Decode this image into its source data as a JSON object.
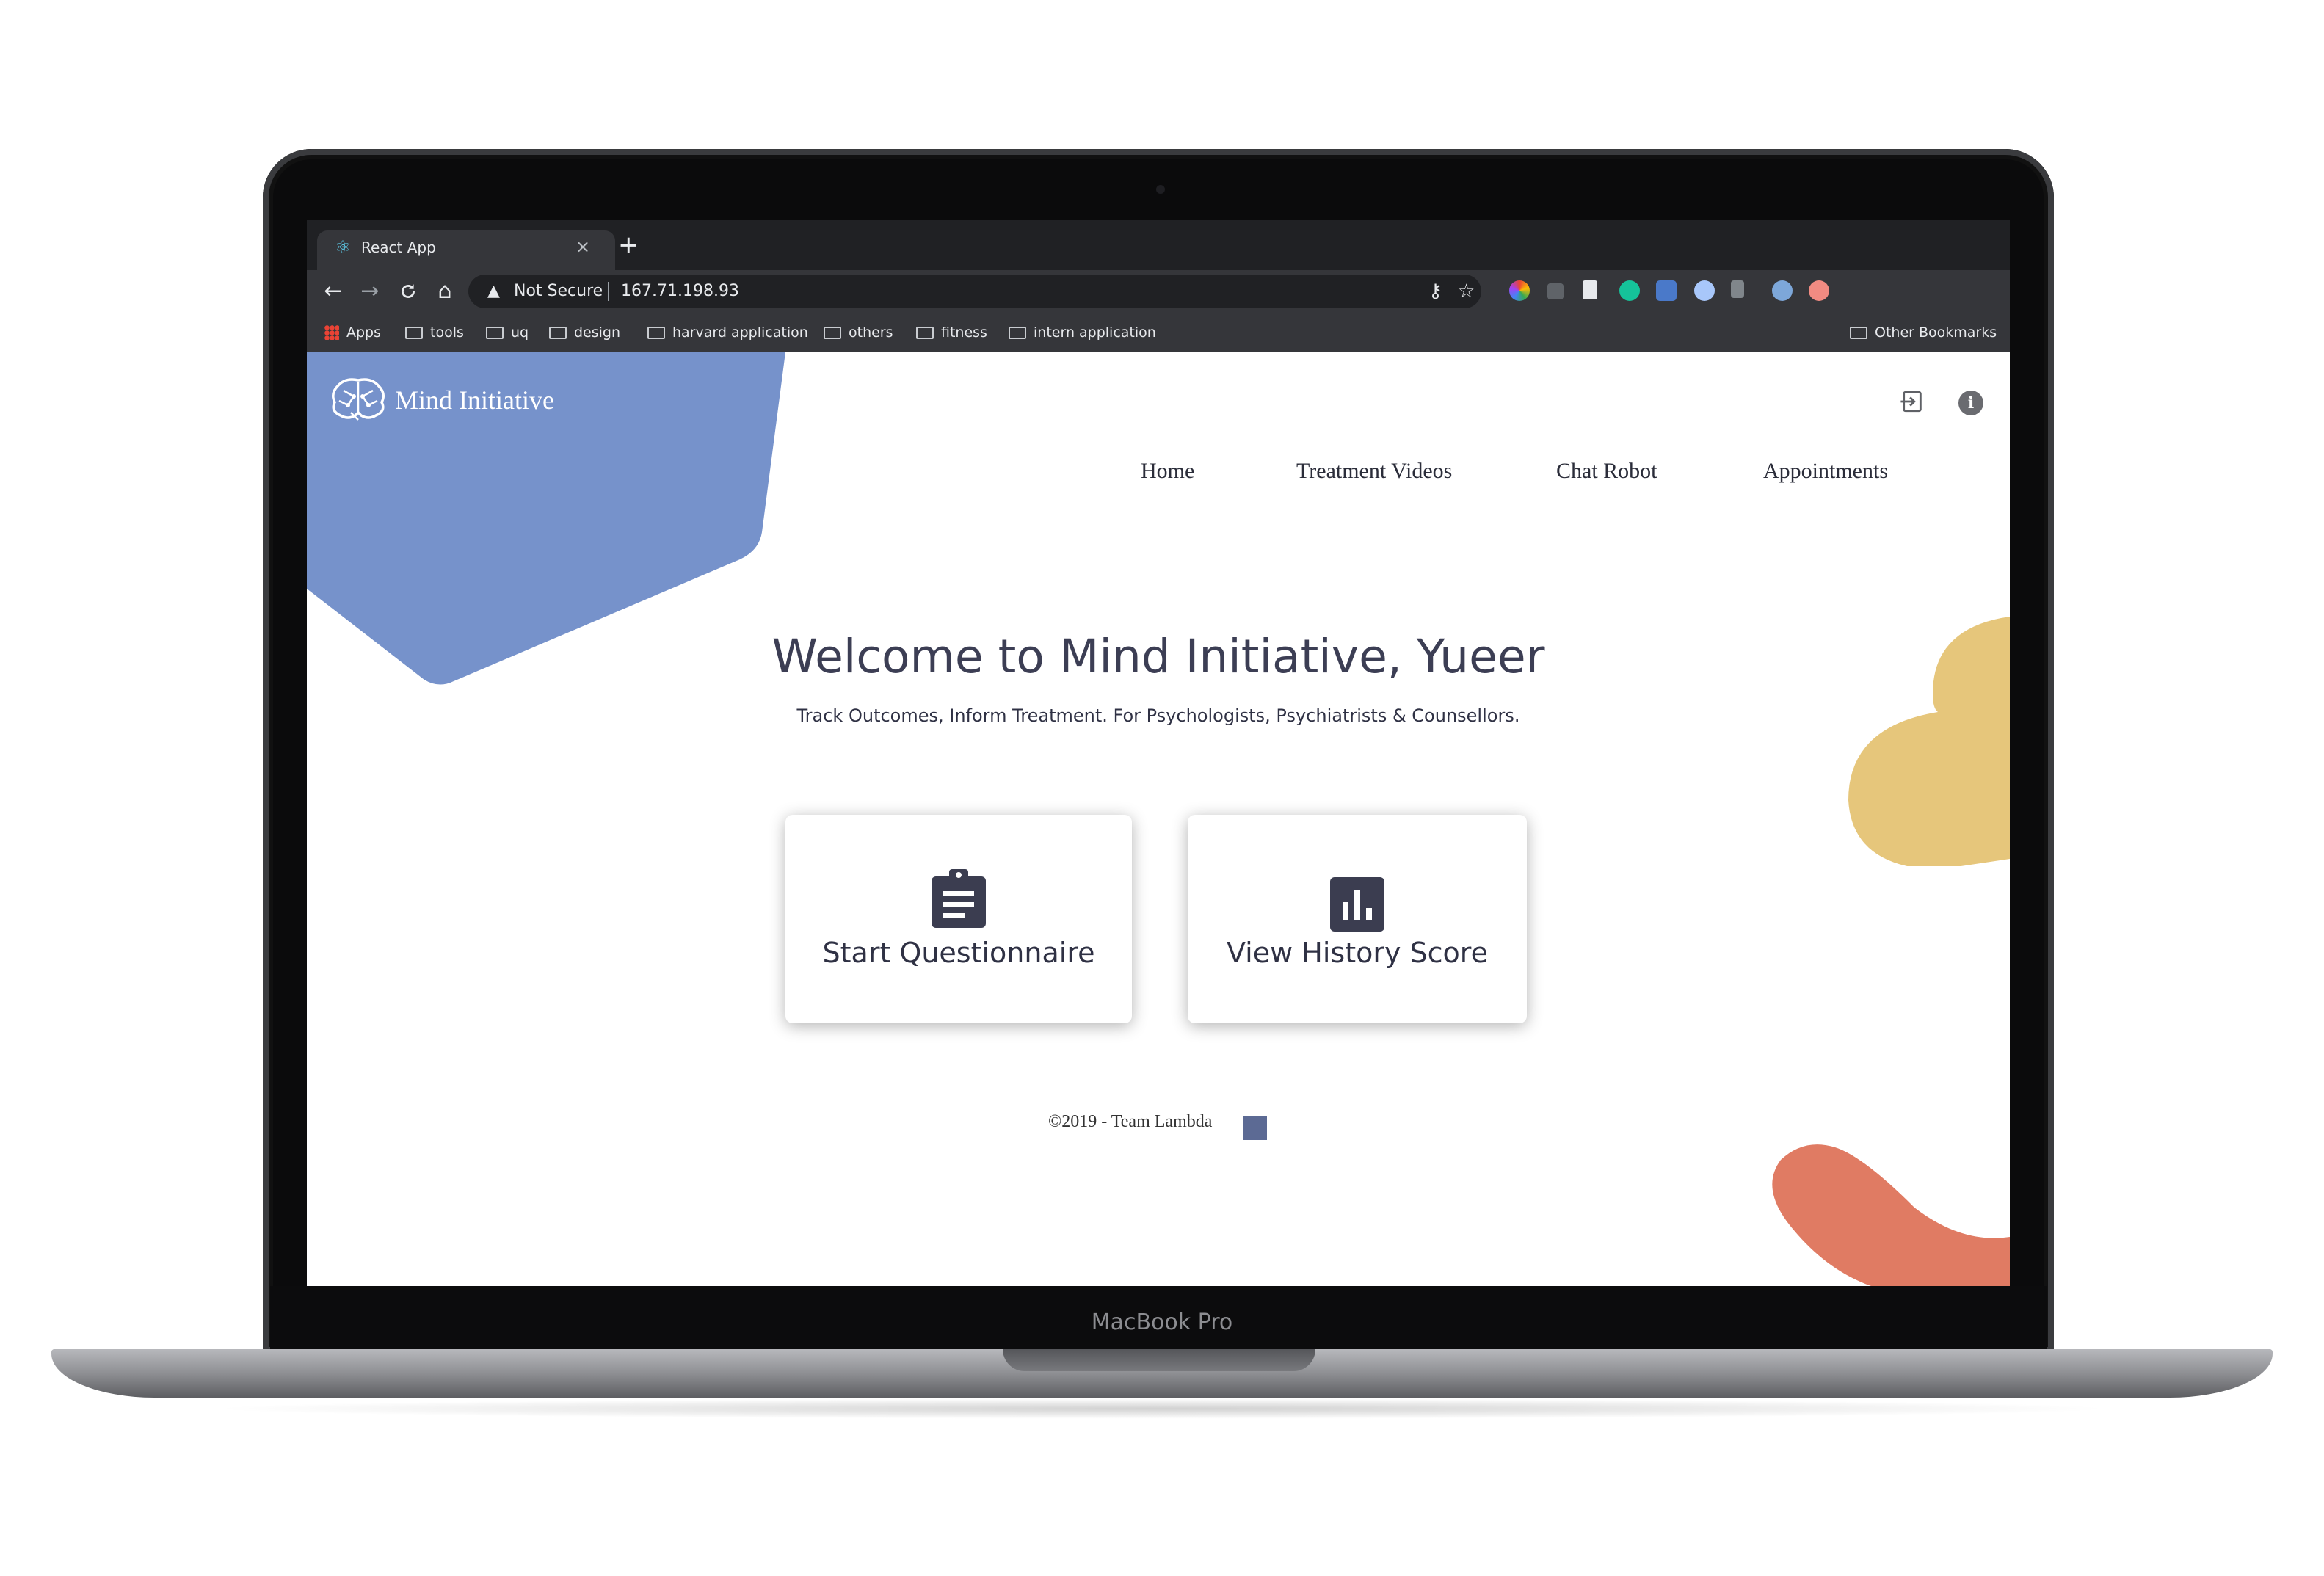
{
  "device": {
    "model_label": "MacBook Pro"
  },
  "browser": {
    "tab_title": "React App",
    "tab_close": "×",
    "new_tab": "+",
    "nav": {
      "back": "←",
      "forward": "→",
      "reload": "C",
      "home": "⌂"
    },
    "security_label": "Not Secure",
    "url": "167.71.198.93",
    "bookmarks": [
      {
        "label": "Apps",
        "icon": "apps-grid-icon"
      },
      {
        "label": "tools",
        "icon": "folder-icon"
      },
      {
        "label": "uq",
        "icon": "folder-icon"
      },
      {
        "label": "design",
        "icon": "folder-icon"
      },
      {
        "label": "harvard application",
        "icon": "folder-icon"
      },
      {
        "label": "others",
        "icon": "folder-icon"
      },
      {
        "label": "fitness",
        "icon": "folder-icon"
      },
      {
        "label": "intern application",
        "icon": "folder-icon"
      }
    ],
    "other_bookmarks": "Other Bookmarks"
  },
  "app": {
    "logo_text": "Mind Initiative",
    "nav_items": [
      "Home",
      "Treatment Videos",
      "Chat Robot",
      "Appointments"
    ],
    "welcome": "Welcome to Mind Initiative, Yueer",
    "tagline": "Track Outcomes, Inform Treatment. For Psychologists, Psychiatrists & Counsellors.",
    "cards": [
      {
        "label": "Start Questionnaire",
        "icon": "clipboard-icon"
      },
      {
        "label": "View History Score",
        "icon": "bar-chart-icon"
      }
    ],
    "footer": "©2019 - Team Lambda",
    "info_icon_glyph": "i"
  },
  "colors": {
    "blue_shape": "#7692cb",
    "yellow_shape": "#e6c67b",
    "orange_shape": "#e07b63",
    "text_dark": "#3c3e54",
    "icon_dark": "#3b3d50"
  }
}
